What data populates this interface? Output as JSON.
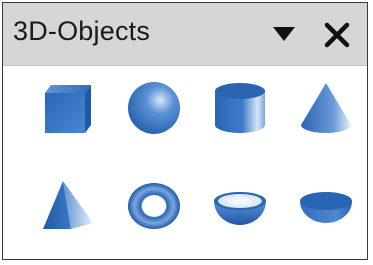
{
  "panel": {
    "title": "3D-Objects",
    "menu_icon": "triangle-down-icon",
    "close_icon": "close-icon"
  },
  "objects": [
    {
      "name": "cube",
      "icon": "cube-icon"
    },
    {
      "name": "sphere",
      "icon": "sphere-icon"
    },
    {
      "name": "cylinder",
      "icon": "cylinder-icon"
    },
    {
      "name": "cone",
      "icon": "cone-icon"
    },
    {
      "name": "pyramid",
      "icon": "pyramid-icon"
    },
    {
      "name": "torus",
      "icon": "torus-icon"
    },
    {
      "name": "shell",
      "icon": "shell-icon"
    },
    {
      "name": "half-sphere",
      "icon": "half-sphere-icon"
    }
  ],
  "colors": {
    "title_bar": "#d6d6d6",
    "shape_blue": "#2f6fc0",
    "shape_light": "#e8f1fb"
  }
}
